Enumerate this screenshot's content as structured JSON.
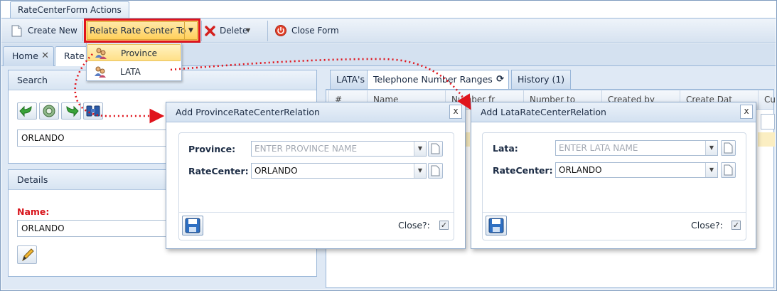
{
  "window": {
    "title": "RateCenterForm Actions"
  },
  "toolbar": {
    "create_new": "Create New",
    "relate": "Relate Rate Center To",
    "delete": "Delete",
    "close_form": "Close Form"
  },
  "relate_menu": {
    "items": [
      {
        "label": "Province",
        "highlighted": true
      },
      {
        "label": "LATA",
        "highlighted": false
      }
    ]
  },
  "tabs": [
    {
      "label": "Home"
    },
    {
      "label": "Rate"
    }
  ],
  "search_panel": {
    "title": "Search",
    "value": "ORLANDO"
  },
  "details_panel": {
    "title": "Details",
    "name_label": "Name:",
    "name_value": "ORLANDO"
  },
  "grid": {
    "tabs": [
      "LATA's",
      "Telephone Number Ranges",
      "History (1)"
    ],
    "columns": [
      "#",
      "Name",
      "Number fr",
      "Number to",
      "Created by",
      "Create Dat",
      "Cu"
    ]
  },
  "province_dialog": {
    "title": "Add ProvinceRateCenterRelation",
    "field1_label": "Province:",
    "field1_placeholder": "ENTER PROVINCE NAME",
    "field2_label": "RateCenter:",
    "field2_value": "ORLANDO",
    "close_label": "Close?:",
    "close_checked": true,
    "close_button": "x"
  },
  "lata_dialog": {
    "title": "Add LataRateCenterRelation",
    "field1_label": "Lata:",
    "field1_placeholder": "ENTER LATA NAME",
    "field2_label": "RateCenter:",
    "field2_value": "ORLANDO",
    "close_label": "Close?:",
    "close_checked": true,
    "close_button": "x"
  },
  "colors": {
    "accent_red": "#e0141c",
    "highlight_yellow": "#ffd97a",
    "label_red": "#d8141b",
    "panel_border": "#99b6d8"
  },
  "icons": {
    "create_new": "document-icon",
    "delete": "red-x-icon",
    "close_form": "power-icon",
    "save": "floppy-disk-icon",
    "edit": "pencil-icon",
    "menu_item": "users-icon"
  }
}
